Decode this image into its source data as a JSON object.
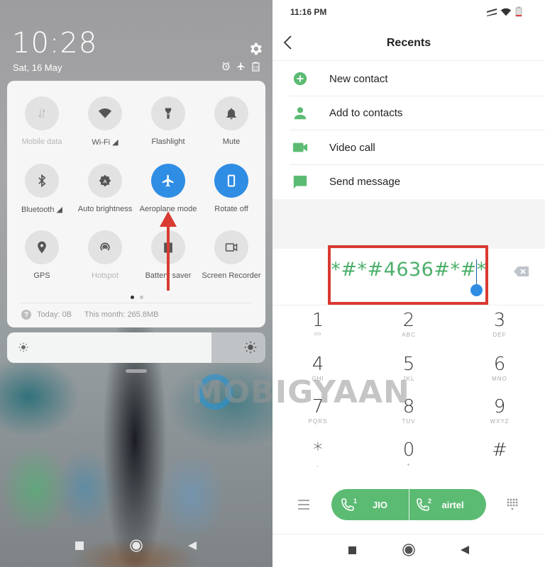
{
  "left_screen": {
    "lock_time": "10:28",
    "lock_date": "Sat, 16 May",
    "status_icons": [
      "alarm-icon",
      "airplane-icon",
      "battery-icon"
    ],
    "quick_settings": {
      "tiles": [
        {
          "label": "Mobile data",
          "icon": "mobile-data-icon",
          "state": "disabled"
        },
        {
          "label": "Wi-Fi ◢",
          "icon": "wifi-icon",
          "state": "off"
        },
        {
          "label": "Flashlight",
          "icon": "flashlight-icon",
          "state": "off"
        },
        {
          "label": "Mute",
          "icon": "bell-icon",
          "state": "off"
        },
        {
          "label": "Bluetooth ◢",
          "icon": "bluetooth-icon",
          "state": "off"
        },
        {
          "label": "Auto brightness",
          "icon": "auto-brightness-icon",
          "state": "off"
        },
        {
          "label": "Aeroplane mode",
          "icon": "airplane-icon",
          "state": "on"
        },
        {
          "label": "Rotate off",
          "icon": "rotate-icon",
          "state": "on"
        },
        {
          "label": "GPS",
          "icon": "location-pin-icon",
          "state": "off"
        },
        {
          "label": "Hotspot",
          "icon": "hotspot-icon",
          "state": "disabled"
        },
        {
          "label": "Battery saver",
          "icon": "battery-saver-icon",
          "state": "off"
        },
        {
          "label": "Screen Recorder",
          "icon": "video-camera-icon",
          "state": "off"
        }
      ],
      "page_index": 1,
      "page_count": 2,
      "data_today": "Today: 0B",
      "data_month": "This month: 265.8MB"
    },
    "brightness_level": 0.79,
    "annotation": "red arrow pointing to Aeroplane mode"
  },
  "right_screen": {
    "status_time": "11:16 PM",
    "header_title": "Recents",
    "menu_items": [
      {
        "label": "New contact",
        "icon": "add-circle-icon"
      },
      {
        "label": "Add to contacts",
        "icon": "person-icon"
      },
      {
        "label": "Video call",
        "icon": "video-camera-icon"
      },
      {
        "label": "Send message",
        "icon": "message-icon"
      }
    ],
    "dialed_number": "*#*#4636#*#*",
    "keypad": [
      {
        "digit": "1",
        "letters": "ᴼᴼ"
      },
      {
        "digit": "2",
        "letters": "ABC"
      },
      {
        "digit": "3",
        "letters": "DEF"
      },
      {
        "digit": "4",
        "letters": "GHI"
      },
      {
        "digit": "5",
        "letters": "JKL"
      },
      {
        "digit": "6",
        "letters": "MNO"
      },
      {
        "digit": "7",
        "letters": "PQRS"
      },
      {
        "digit": "8",
        "letters": "TUV"
      },
      {
        "digit": "9",
        "letters": "WXYZ"
      },
      {
        "digit": "*",
        "letters": ","
      },
      {
        "digit": "0",
        "letters": "+"
      },
      {
        "digit": "#",
        "letters": ""
      }
    ],
    "sim_buttons": [
      {
        "label": "JIO",
        "sim_index": "1"
      },
      {
        "label": "airtel",
        "sim_index": "2"
      }
    ],
    "colors": {
      "accent_green": "#5cbb73",
      "highlight_red": "#d93a32",
      "active_blue": "#2f8de4"
    }
  },
  "watermark": "MOBIGYAAN"
}
